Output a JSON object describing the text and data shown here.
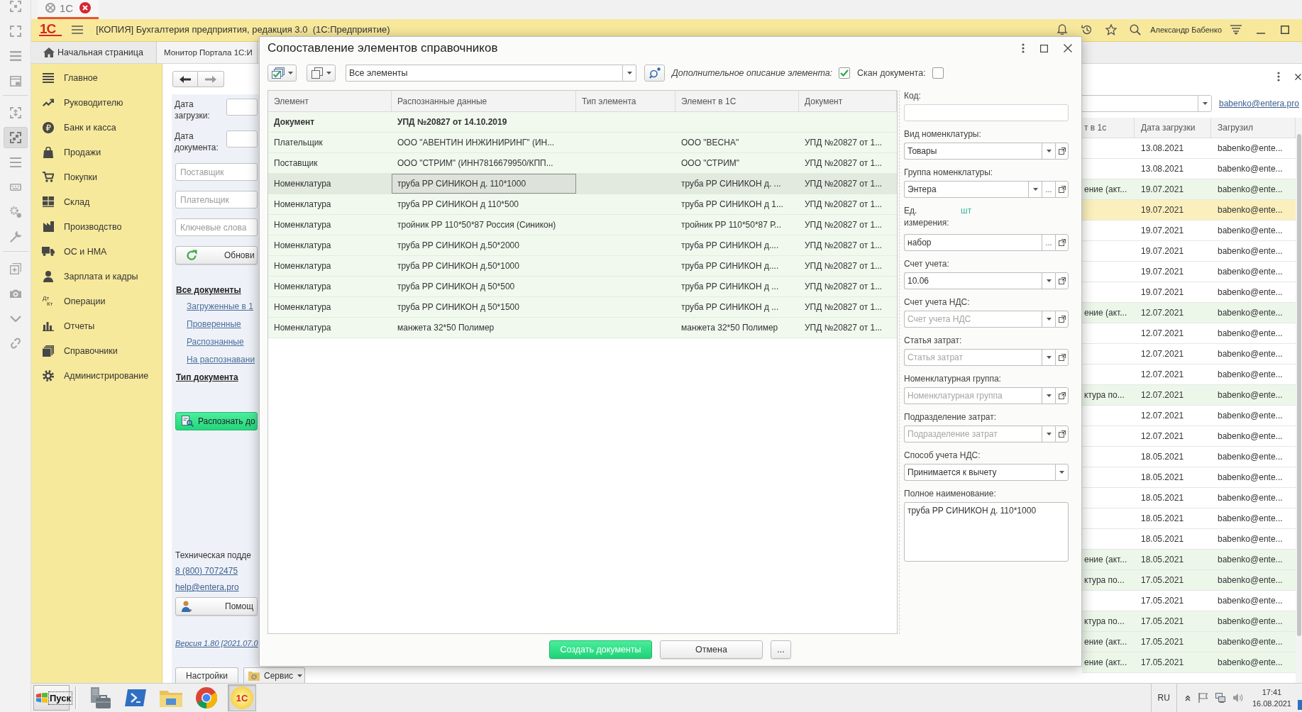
{
  "browser_tab": {
    "title": "1С"
  },
  "left_toolbar": {
    "groups": [
      [
        {
          "selected": false
        },
        {
          "selected": false
        },
        {
          "selected": false
        },
        {
          "selected": false
        }
      ],
      [
        {
          "selected": false
        },
        {
          "selected": true
        },
        {
          "selected": false
        },
        {
          "selected": false
        },
        {
          "selected": false
        },
        {
          "selected": false
        }
      ],
      [
        {
          "selected": false
        },
        {
          "selected": false
        },
        {
          "selected": false
        },
        {
          "selected": false
        }
      ]
    ]
  },
  "header": {
    "logo": "1С",
    "title": "[КОПИЯ] Бухгалтерия предприятия, редакция 3.0  (1С:Предприятие)",
    "user": "Александр Бабенко"
  },
  "tabs": [
    {
      "kind": "home",
      "label": "Начальная страница"
    },
    {
      "kind": "form",
      "label": "Монитор Портала 1С:И"
    }
  ],
  "sidebar": {
    "items": [
      {
        "label": "Главное"
      },
      {
        "label": "Руководителю"
      },
      {
        "label": "Банк и касса"
      },
      {
        "label": "Продажи"
      },
      {
        "label": "Покупки"
      },
      {
        "label": "Склад"
      },
      {
        "label": "Производство"
      },
      {
        "label": "ОС и НМА"
      },
      {
        "label": "Зарплата и кадры"
      },
      {
        "label": "Операции",
        "icon_text": [
          "Дт",
          "Кт"
        ]
      },
      {
        "label": "Отчеты"
      },
      {
        "label": "Справочники"
      },
      {
        "label": "Администрирование"
      }
    ]
  },
  "monitor": {
    "date_filters": [
      {
        "label": "Дата загрузки:"
      },
      {
        "label": "Дата документа:"
      }
    ],
    "search_fields": [
      {
        "placeholder": "Поставщик"
      },
      {
        "placeholder": "Плательщик"
      },
      {
        "placeholder": "Ключевые слова"
      }
    ],
    "refresh_button": "Обнови",
    "all_documents": "Все документы",
    "status_links": [
      "Загруженные в 1",
      "Проверенные",
      "Распознанные",
      "На распознавани"
    ],
    "document_type": "Тип документа",
    "recognize_button": "Распознать до",
    "support": {
      "label": "Техническая подде",
      "phone": "8 (800) 7072475",
      "email": "help@entera.pro",
      "help_button": "Помощ",
      "version": "Версия 1.80 [2021.07.0"
    },
    "footer_buttons": [
      {
        "kind": "plain",
        "label": "Настройки"
      },
      {
        "kind": "menu",
        "label": "Сервис"
      }
    ]
  },
  "documents_table": {
    "user_filter": "babenko@entera.pro",
    "columns": [
      "т в 1с",
      "Дата загрузки",
      "Загрузил"
    ],
    "rows": [
      {
        "date": "13.08.2021",
        "user": "babenko@ente...",
        "highlighted": false,
        "selected": false
      },
      {
        "date": "13.08.2021",
        "user": "babenko@ente...",
        "highlighted": false,
        "selected": false
      },
      {
        "column_1": "ение (акт...",
        "date": "19.07.2021",
        "user": "babenko@ente...",
        "highlighted": true,
        "selected": false
      },
      {
        "date": "19.07.2021",
        "user": "babenko@ente...",
        "highlighted": false,
        "selected": true
      },
      {
        "date": "19.07.2021",
        "user": "babenko@ente...",
        "highlighted": false,
        "selected": false
      },
      {
        "date": "19.07.2021",
        "user": "babenko@ente...",
        "highlighted": false,
        "selected": false
      },
      {
        "date": "19.07.2021",
        "user": "babenko@ente...",
        "highlighted": false,
        "selected": false
      },
      {
        "date": "19.07.2021",
        "user": "babenko@ente...",
        "highlighted": false,
        "selected": false
      },
      {
        "column_1": "ение (акт...",
        "date": "12.07.2021",
        "user": "babenko@ente...",
        "highlighted": true,
        "selected": false
      },
      {
        "date": "12.07.2021",
        "user": "babenko@ente...",
        "highlighted": false,
        "selected": false
      },
      {
        "date": "12.07.2021",
        "user": "babenko@ente...",
        "highlighted": false,
        "selected": false
      },
      {
        "date": "12.07.2021",
        "user": "babenko@ente...",
        "highlighted": false,
        "selected": false
      },
      {
        "column_1": "ктура по...",
        "date": "12.07.2021",
        "user": "babenko@ente...",
        "highlighted": true,
        "selected": false
      },
      {
        "date": "12.07.2021",
        "user": "babenko@ente...",
        "highlighted": false,
        "selected": false
      },
      {
        "date": "12.07.2021",
        "user": "babenko@ente...",
        "highlighted": false,
        "selected": false
      },
      {
        "date": "18.05.2021",
        "user": "babenko@ente...",
        "highlighted": false,
        "selected": false
      },
      {
        "date": "18.05.2021",
        "user": "babenko@ente...",
        "highlighted": false,
        "selected": false
      },
      {
        "date": "18.05.2021",
        "user": "babenko@ente...",
        "highlighted": false,
        "selected": false
      },
      {
        "date": "18.05.2021",
        "user": "babenko@ente...",
        "highlighted": false,
        "selected": false
      },
      {
        "date": "18.05.2021",
        "user": "babenko@ente...",
        "highlighted": false,
        "selected": false
      },
      {
        "column_1": "ение (акт...",
        "date": "18.05.2021",
        "user": "babenko@ente...",
        "highlighted": true,
        "selected": false
      },
      {
        "column_1": "ктура по...",
        "date": "17.05.2021",
        "user": "babenko@ente...",
        "highlighted": true,
        "selected": false
      },
      {
        "date": "17.05.2021",
        "user": "babenko@ente...",
        "highlighted": false,
        "selected": false
      },
      {
        "column_1": "ктура по...",
        "date": "17.05.2021",
        "user": "babenko@ente...",
        "highlighted": true,
        "selected": false
      },
      {
        "column_1": "ение (акт...",
        "date": "17.05.2021",
        "user": "babenko@ente...",
        "highlighted": true,
        "selected": false
      },
      {
        "column_1": "ение (акт...",
        "date": "17.05.2021",
        "user": "babenko@ente...",
        "highlighted": true,
        "selected": false
      }
    ]
  },
  "dialog": {
    "title": "Сопоставление элементов справочников",
    "toolbar": {
      "filter": "Все элементы",
      "description_option": {
        "label": "Дополнительное описание элемента:",
        "checked": true
      },
      "scan_option": {
        "label": "Скан документа:",
        "checked": false
      }
    },
    "table": {
      "columns": [
        "Элемент",
        "Распознанные данные",
        "Тип элемента",
        "Элемент в 1С",
        "Документ"
      ],
      "rows": [
        {
          "kind": "group",
          "element": "Документ",
          "recognized_data": "УПД №20827 от 14.10.2019",
          "selected": false
        },
        {
          "kind": "item",
          "element": "Плательщик",
          "recognized_data": "ООО \"АВЕНТИН ИНЖИНИРИНГ\" (ИН...",
          "element_in_1c": "ООО \"ВЕСНА\"",
          "document": "УПД №20827 от 1...",
          "selected": false
        },
        {
          "kind": "item",
          "element": "Поставщик",
          "recognized_data": "ООО \"СТРИМ\" (ИНН7816679950/КПП...",
          "element_in_1c": "ООО \"СТРИМ\"",
          "document": "УПД №20827 от 1...",
          "selected": false
        },
        {
          "kind": "item",
          "element": "Номенклатура",
          "recognized_data": "труба РР СИНИКОН д. 110*1000",
          "element_in_1c": "труба РР СИНИКОН д. ...",
          "document": "УПД №20827 от 1...",
          "selected": true
        },
        {
          "kind": "item",
          "element": "Номенклатура",
          "recognized_data": "труба РР СИНИКОН д 110*500",
          "element_in_1c": "труба РР СИНИКОН д 1...",
          "document": "УПД №20827 от 1...",
          "selected": false
        },
        {
          "kind": "item",
          "element": "Номенклатура",
          "recognized_data": "тройник РР 110*50*87 Россия (Синикон)",
          "element_in_1c": "тройник РР 110*50*87 Р...",
          "document": "УПД №20827 от 1...",
          "selected": false
        },
        {
          "kind": "item",
          "element": "Номенклатура",
          "recognized_data": "труба РР СИНИКОН д.50*2000",
          "element_in_1c": "труба РР СИНИКОН д....",
          "document": "УПД №20827 от 1...",
          "selected": false
        },
        {
          "kind": "item",
          "element": "Номенклатура",
          "recognized_data": "труба РР СИНИКОН д.50*1000",
          "element_in_1c": "труба РР СИНИКОН д....",
          "document": "УПД №20827 от 1...",
          "selected": false
        },
        {
          "kind": "item",
          "element": "Номенклатура",
          "recognized_data": "труба РР СИНИКОН д 50*500",
          "element_in_1c": "труба РР СИНИКОН д ...",
          "document": "УПД №20827 от 1...",
          "selected": false
        },
        {
          "kind": "item",
          "element": "Номенклатура",
          "recognized_data": "труба РР СИНИКОН д 50*1500",
          "element_in_1c": "труба РР СИНИКОН д ...",
          "document": "УПД №20827 от 1...",
          "selected": false
        },
        {
          "kind": "item",
          "element": "Номенклатура",
          "recognized_data": "манжета 32*50 Полимер",
          "element_in_1c": "манжета 32*50 Полимер",
          "document": "УПД №20827 от 1...",
          "selected": false
        }
      ]
    },
    "details": {
      "fields": [
        {
          "kind": "text",
          "label": "Код:"
        },
        {
          "kind": "select",
          "label": "Вид номенклатуры:",
          "value": "Товары",
          "buttons": [
            {
              "kind": "dropdown"
            },
            {
              "kind": "open"
            }
          ]
        },
        {
          "kind": "select",
          "label": "Группа номенклатуры:",
          "value": "Энтера",
          "buttons": [
            {
              "kind": "dropdown"
            },
            {
              "kind": "choose",
              "text": "..."
            },
            {
              "kind": "open"
            }
          ]
        },
        {
          "kind": "select",
          "label": "Ед. измерения:",
          "link": "шт",
          "value": "набор",
          "buttons": [
            {
              "kind": "choose",
              "text": "..."
            },
            {
              "kind": "open"
            }
          ]
        },
        {
          "kind": "select",
          "label": "Счет учета:",
          "value": "10.06",
          "buttons": [
            {
              "kind": "dropdown"
            },
            {
              "kind": "open"
            }
          ]
        },
        {
          "kind": "select",
          "label": "Счет учета НДС:",
          "placeholder": "Счет учета НДС",
          "buttons": [
            {
              "kind": "dropdown"
            },
            {
              "kind": "open"
            }
          ]
        },
        {
          "kind": "select",
          "label": "Статья затрат:",
          "placeholder": "Статья затрат",
          "buttons": [
            {
              "kind": "dropdown"
            },
            {
              "kind": "open"
            }
          ]
        },
        {
          "kind": "select",
          "label": "Номенклатурная группа:",
          "placeholder": "Номенклатурная группа",
          "buttons": [
            {
              "kind": "dropdown"
            },
            {
              "kind": "open"
            }
          ]
        },
        {
          "kind": "select",
          "label": "Подразделение затрат:",
          "placeholder": "Подразделение затрат",
          "buttons": [
            {
              "kind": "dropdown"
            },
            {
              "kind": "open"
            }
          ]
        },
        {
          "kind": "select",
          "label": "Способ учета НДС:",
          "value": "Принимается к вычету",
          "buttons": [
            {
              "kind": "dropdown"
            }
          ]
        },
        {
          "kind": "textarea",
          "label": "Полное наименование:",
          "value": "труба РР СИНИКОН д. 110*1000"
        }
      ]
    },
    "buttons": [
      {
        "kind": "primary",
        "label": "Создать документы"
      },
      {
        "kind": "default",
        "label": "Отмена"
      },
      {
        "kind": "more",
        "label": "..."
      }
    ]
  },
  "taskbar": {
    "start": "Пуск",
    "apps": [
      {
        "kind": "icon",
        "selected": false
      },
      {
        "kind": "icon",
        "selected": false
      },
      {
        "kind": "icon",
        "selected": false
      },
      {
        "kind": "icon",
        "selected": false
      },
      {
        "kind": "logo",
        "label": "1С",
        "selected": true
      }
    ],
    "language": "RU",
    "time": "17:41",
    "date": "16.08.2021"
  }
}
